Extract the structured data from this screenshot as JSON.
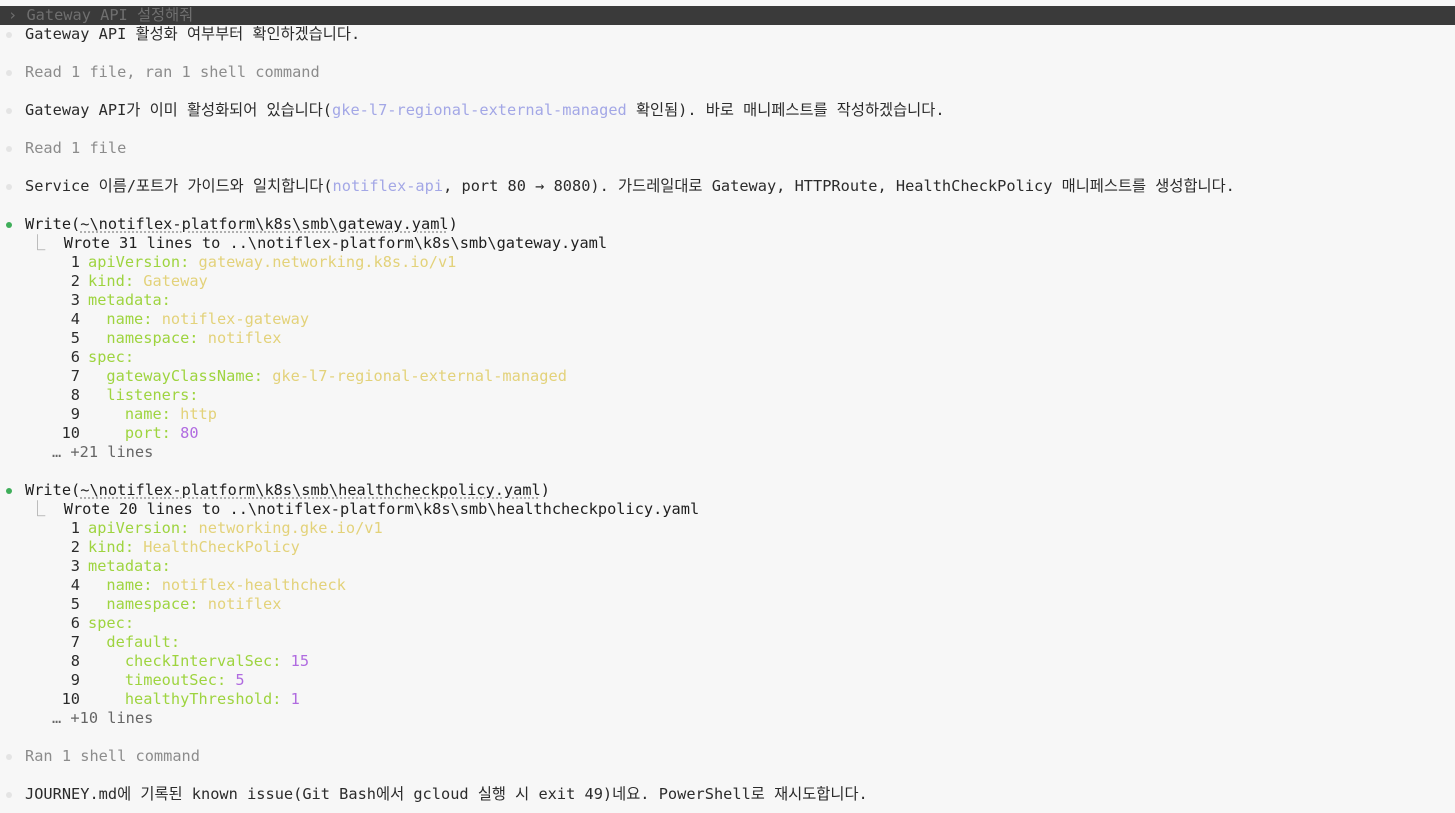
{
  "prompt": {
    "chevron": "›",
    "text": "Gateway API 설정해줘"
  },
  "messages": {
    "m1": "Gateway API 활성화 여부부터 확인하겠습니다.",
    "s1": "Read 1 file, ran 1 shell command",
    "m2_pre": "Gateway API가 이미 활성화되어 있습니다(",
    "m2_link": "gke-l7-regional-external-managed",
    "m2_post": " 확인됨). 바로 매니페스트를 작성하겠습니다.",
    "s2": "Read 1 file",
    "m3_pre": "Service 이름/포트가 가이드와 일치합니다(",
    "m3_link": "notiflex-api",
    "m3_post": ", port 80 → 8080). 가드레일대로 Gateway, HTTPRoute, HealthCheckPolicy 매니페스트를 생성합니다.",
    "s3": "Ran 1 shell command",
    "m4": "JOURNEY.md에 기록된 known issue(Git Bash에서 gcloud 실행 시 exit 49)네요. PowerShell로 재시도합니다."
  },
  "write1": {
    "tool": "Write(",
    "path": "~\\notiflex-platform\\k8s\\smb\\gateway.yaml",
    "close": ")",
    "branch": "⎿",
    "result": "Wrote 31 lines to ..\\notiflex-platform\\k8s\\smb\\gateway.yaml",
    "lines": [
      {
        "n": "1",
        "indent": "",
        "key": "apiVersion:",
        "val": " gateway.networking.k8s.io/v1",
        "num": ""
      },
      {
        "n": "2",
        "indent": "",
        "key": "kind:",
        "val": " Gateway",
        "num": ""
      },
      {
        "n": "3",
        "indent": "",
        "key": "metadata:",
        "val": "",
        "num": ""
      },
      {
        "n": "4",
        "indent": "  ",
        "key": "name:",
        "val": " notiflex-gateway",
        "num": ""
      },
      {
        "n": "5",
        "indent": "  ",
        "key": "namespace:",
        "val": " notiflex",
        "num": ""
      },
      {
        "n": "6",
        "indent": "",
        "key": "spec:",
        "val": "",
        "num": ""
      },
      {
        "n": "7",
        "indent": "  ",
        "key": "gatewayClassName:",
        "val": " gke-l7-regional-external-managed",
        "num": ""
      },
      {
        "n": "8",
        "indent": "  ",
        "key": "listeners:",
        "val": "",
        "num": ""
      },
      {
        "n": "9",
        "indent": "    ",
        "key": "name:",
        "val": " http",
        "num": ""
      },
      {
        "n": "10",
        "indent": "    ",
        "key": "port:",
        "val": "",
        "num": " 80"
      }
    ],
    "more": "… +21 lines"
  },
  "write2": {
    "tool": "Write(",
    "path": "~\\notiflex-platform\\k8s\\smb\\healthcheckpolicy.yaml",
    "close": ")",
    "branch": "⎿",
    "result": "Wrote 20 lines to ..\\notiflex-platform\\k8s\\smb\\healthcheckpolicy.yaml",
    "lines": [
      {
        "n": "1",
        "indent": "",
        "key": "apiVersion:",
        "val": " networking.gke.io/v1",
        "num": ""
      },
      {
        "n": "2",
        "indent": "",
        "key": "kind:",
        "val": " HealthCheckPolicy",
        "num": ""
      },
      {
        "n": "3",
        "indent": "",
        "key": "metadata:",
        "val": "",
        "num": ""
      },
      {
        "n": "4",
        "indent": "  ",
        "key": "name:",
        "val": " notiflex-healthcheck",
        "num": ""
      },
      {
        "n": "5",
        "indent": "  ",
        "key": "namespace:",
        "val": " notiflex",
        "num": ""
      },
      {
        "n": "6",
        "indent": "",
        "key": "spec:",
        "val": "",
        "num": ""
      },
      {
        "n": "7",
        "indent": "  ",
        "key": "default:",
        "val": "",
        "num": ""
      },
      {
        "n": "8",
        "indent": "    ",
        "key": "checkIntervalSec:",
        "val": "",
        "num": " 15"
      },
      {
        "n": "9",
        "indent": "    ",
        "key": "timeoutSec:",
        "val": "",
        "num": " 5"
      },
      {
        "n": "10",
        "indent": "    ",
        "key": "healthyThreshold:",
        "val": "",
        "num": " 1"
      }
    ],
    "more": "… +10 lines"
  },
  "colors": {
    "background": "#f7f7f7",
    "success_dot": "#3fae5a",
    "yaml_key": "#9ed43f",
    "yaml_value": "#e3d27a",
    "yaml_number": "#b06be0",
    "link": "#a3a7e6"
  }
}
